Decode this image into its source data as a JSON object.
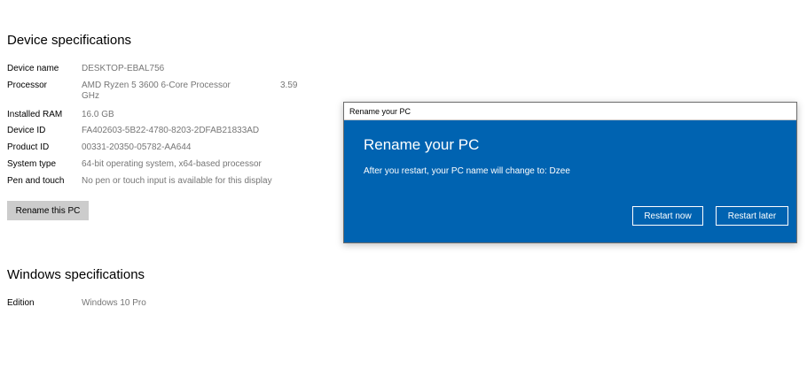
{
  "device_specs": {
    "title": "Device specifications",
    "rows": [
      {
        "label": "Device name",
        "value": "DESKTOP-EBAL756"
      },
      {
        "label": "Processor",
        "value": "AMD Ryzen 5 3600 6-Core Processor",
        "value_freq": "3.59",
        "value_unit": "GHz"
      },
      {
        "label": "Installed RAM",
        "value": "16.0 GB"
      },
      {
        "label": "Device ID",
        "value": "FA402603-5B22-4780-8203-2DFAB21833AD"
      },
      {
        "label": "Product ID",
        "value": "00331-20350-05782-AA644"
      },
      {
        "label": "System type",
        "value": "64-bit operating system, x64-based processor"
      },
      {
        "label": "Pen and touch",
        "value": "No pen or touch input is available for this display"
      }
    ],
    "rename_button": "Rename this PC"
  },
  "windows_specs": {
    "title": "Windows specifications",
    "rows": [
      {
        "label": "Edition",
        "value": "Windows 10 Pro"
      }
    ]
  },
  "dialog": {
    "titlebar": "Rename your PC",
    "heading": "Rename your PC",
    "message": "After you restart, your PC name will change to: Dzee",
    "restart_now": "Restart now",
    "restart_later": "Restart later",
    "accent_color": "#0063b1"
  }
}
